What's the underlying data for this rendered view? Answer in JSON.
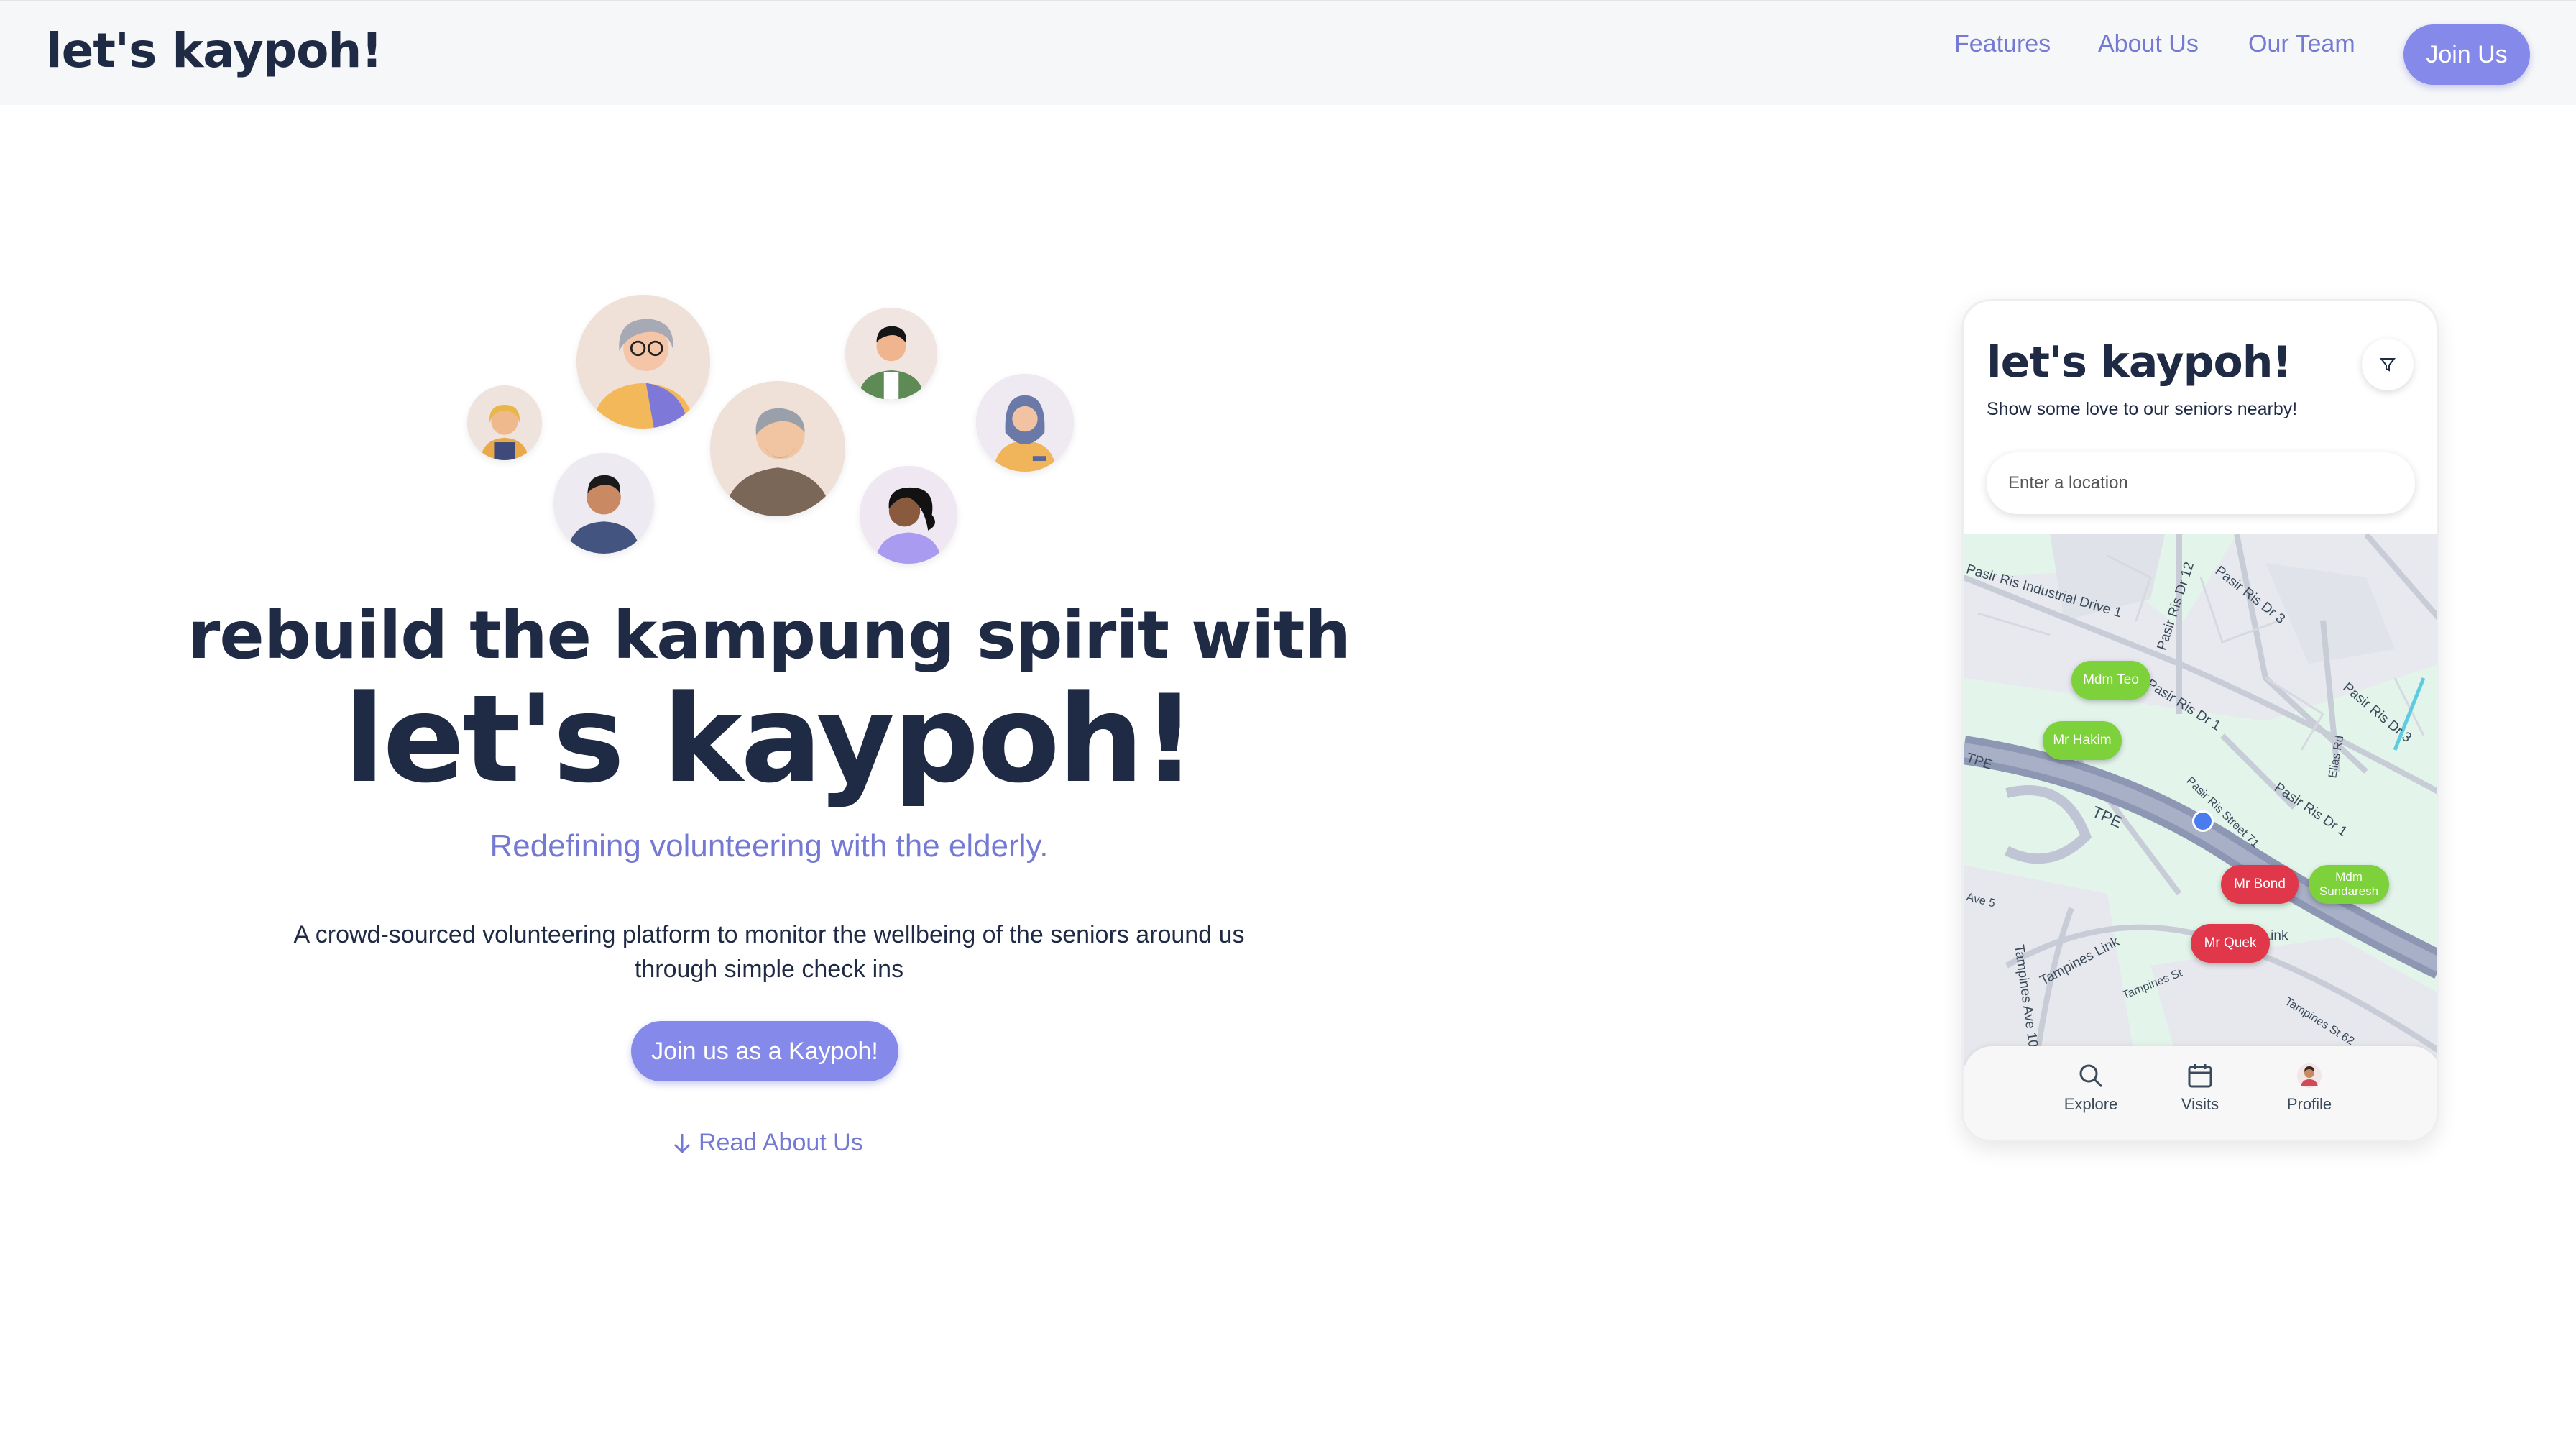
{
  "header": {
    "brand": "let's kaypoh!",
    "nav": [
      "Features",
      "About Us",
      "Our Team"
    ],
    "join_label": "Join Us"
  },
  "hero": {
    "headline_1": "rebuild the kampung spirit with",
    "headline_2": "let's kaypoh!",
    "tagline": "Redefining volunteering with the elderly.",
    "description": "A crowd-sourced volunteering platform to monitor the wellbeing of the seniors around us through simple check ins",
    "cta_label": "Join us as a Kaypoh!",
    "read_link": "Read About Us"
  },
  "phone": {
    "title": "let's kaypoh!",
    "subtitle": "Show some love to our seniors nearby!",
    "search_placeholder": "Enter a location",
    "streets": [
      "Pasir Ris Industrial Drive 1",
      "Pasir Ris Dr 12",
      "Pasir Ris Dr 3",
      "Pasir Ris Dr 1",
      "Pasir Ris Street 71",
      "Pasir Ris Dr 1",
      "Pasir Ris Dr 3",
      "Elias Rd",
      "TPE",
      "TPE",
      "Tampines Link",
      "Tampines Link",
      "Tampines Ave 10",
      "Tampines St 62",
      "Tampines St",
      "Ave 5"
    ],
    "pins": [
      {
        "label": "Mdm Teo",
        "status": "green"
      },
      {
        "label": "Mr Hakim",
        "status": "green"
      },
      {
        "label": "Mr Bond",
        "status": "red"
      },
      {
        "label": "Mdm Sundaresh",
        "status": "green"
      },
      {
        "label": "Mr Quek",
        "status": "red"
      }
    ],
    "tabs": [
      "Explore",
      "Visits",
      "Profile"
    ]
  },
  "colors": {
    "accent": "#8489ea",
    "nav_text": "#7479d4",
    "heading": "#1f2a44",
    "pin_ok": "#7dd13a",
    "pin_alert": "#e0384a"
  }
}
